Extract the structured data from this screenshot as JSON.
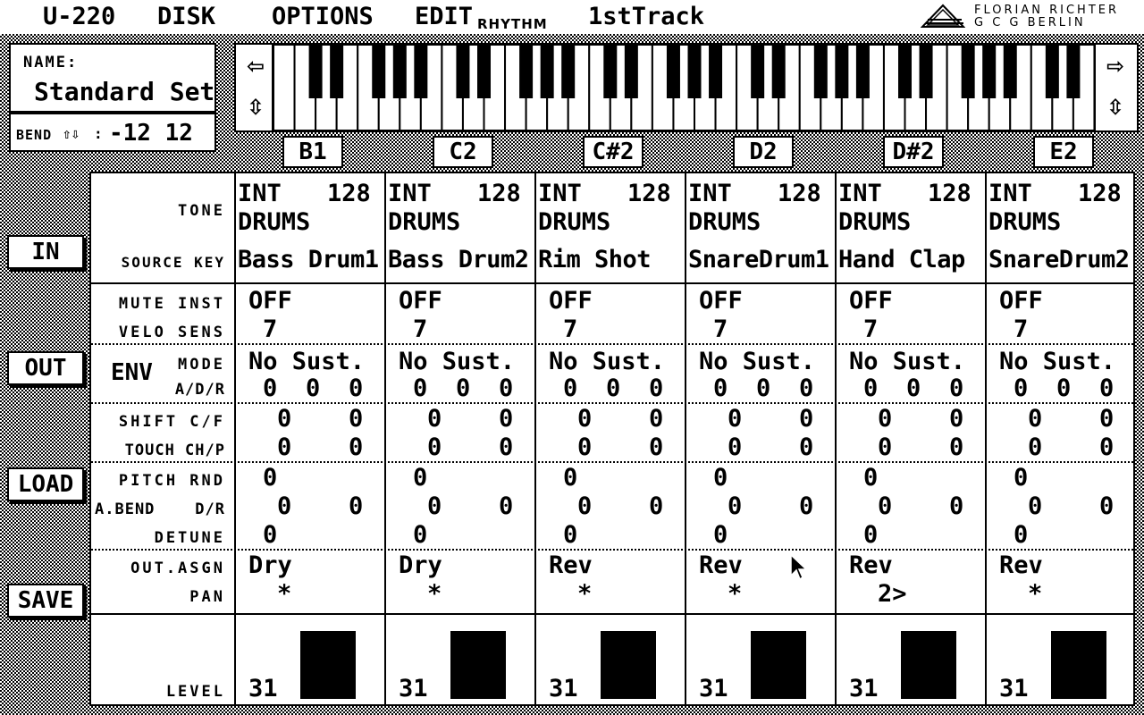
{
  "menu": {
    "app": "U-220",
    "disk": "DISK",
    "options": "OPTIONS",
    "edit": "EDIT",
    "edit_sub": "RHYTHM",
    "track": "1stTrack"
  },
  "logo": {
    "line1": "FLORIAN RICHTER",
    "line2": "G C G BERLIN"
  },
  "name": {
    "label": "NAME:",
    "value": "Standard Set"
  },
  "bend": {
    "label": "BEND",
    "arrows": "⇧⇩",
    "colon": ":",
    "value": "-12 12"
  },
  "keyboard": {
    "left_top": "⇦",
    "left_bottom": "⇳",
    "right_top": "⇨",
    "right_bottom": "⇳"
  },
  "notes": [
    "B1",
    "C2",
    "C#2",
    "D2",
    "D#2",
    "E2"
  ],
  "side_buttons": {
    "in": "IN",
    "out": "OUT",
    "load": "LOAD",
    "save": "SAVE"
  },
  "row_labels": {
    "tone": "TONE",
    "source_key": "SOURCE KEY",
    "mute_inst": "MUTE INST",
    "velo_sens": "VELO SENS",
    "env": "ENV",
    "mode": "MODE",
    "adr": "A/D/R",
    "shift": "SHIFT C/F",
    "touch": "TOUCH CH/P",
    "pitch_rnd": "PITCH RND",
    "abend": "A.BEND",
    "abend_dr": "D/R",
    "detune": "DETUNE",
    "out_asgn": "OUT.ASGN",
    "pan": "PAN",
    "level": "LEVEL"
  },
  "columns": [
    {
      "tone_type": "INT",
      "tone_num": "128",
      "tone_group": "DRUMS",
      "source": "Bass Drum1",
      "mute": "OFF",
      "velo": "7",
      "mode": "No Sust.",
      "a": "0",
      "d": "0",
      "r": "0",
      "shift_c": "0",
      "shift_f": "0",
      "touch_ch": "0",
      "touch_p": "0",
      "pitch_rnd": "0",
      "abend_d": "0",
      "abend_r": "0",
      "detune": "0",
      "out_asgn": "Dry",
      "pan": "*",
      "level": "31",
      "level_value": 31
    },
    {
      "tone_type": "INT",
      "tone_num": "128",
      "tone_group": "DRUMS",
      "source": "Bass Drum2",
      "mute": "OFF",
      "velo": "7",
      "mode": "No Sust.",
      "a": "0",
      "d": "0",
      "r": "0",
      "shift_c": "0",
      "shift_f": "0",
      "touch_ch": "0",
      "touch_p": "0",
      "pitch_rnd": "0",
      "abend_d": "0",
      "abend_r": "0",
      "detune": "0",
      "out_asgn": "Dry",
      "pan": "*",
      "level": "31",
      "level_value": 31
    },
    {
      "tone_type": "INT",
      "tone_num": "128",
      "tone_group": "DRUMS",
      "source": "Rim Shot",
      "mute": "OFF",
      "velo": "7",
      "mode": "No Sust.",
      "a": "0",
      "d": "0",
      "r": "0",
      "shift_c": "0",
      "shift_f": "0",
      "touch_ch": "0",
      "touch_p": "0",
      "pitch_rnd": "0",
      "abend_d": "0",
      "abend_r": "0",
      "detune": "0",
      "out_asgn": "Rev",
      "pan": "*",
      "level": "31",
      "level_value": 31
    },
    {
      "tone_type": "INT",
      "tone_num": "128",
      "tone_group": "DRUMS",
      "source": "SnareDrum1",
      "mute": "OFF",
      "velo": "7",
      "mode": "No Sust.",
      "a": "0",
      "d": "0",
      "r": "0",
      "shift_c": "0",
      "shift_f": "0",
      "touch_ch": "0",
      "touch_p": "0",
      "pitch_rnd": "0",
      "abend_d": "0",
      "abend_r": "0",
      "detune": "0",
      "out_asgn": "Rev",
      "pan": "*",
      "level": "31",
      "level_value": 31
    },
    {
      "tone_type": "INT",
      "tone_num": "128",
      "tone_group": "DRUMS",
      "source": "Hand Clap",
      "mute": "OFF",
      "velo": "7",
      "mode": "No Sust.",
      "a": "0",
      "d": "0",
      "r": "0",
      "shift_c": "0",
      "shift_f": "0",
      "touch_ch": "0",
      "touch_p": "0",
      "pitch_rnd": "0",
      "abend_d": "0",
      "abend_r": "0",
      "detune": "0",
      "out_asgn": "Rev",
      "pan": "2>",
      "level": "31",
      "level_value": 31
    },
    {
      "tone_type": "INT",
      "tone_num": "128",
      "tone_group": "DRUMS",
      "source": "SnareDrum2",
      "mute": "OFF",
      "velo": "7",
      "mode": "No Sust.",
      "a": "0",
      "d": "0",
      "r": "0",
      "shift_c": "0",
      "shift_f": "0",
      "touch_ch": "0",
      "touch_p": "0",
      "pitch_rnd": "0",
      "abend_d": "0",
      "abend_r": "0",
      "detune": "0",
      "out_asgn": "Rev",
      "pan": "*",
      "level": "31",
      "level_value": 31
    }
  ],
  "level_max": 31
}
